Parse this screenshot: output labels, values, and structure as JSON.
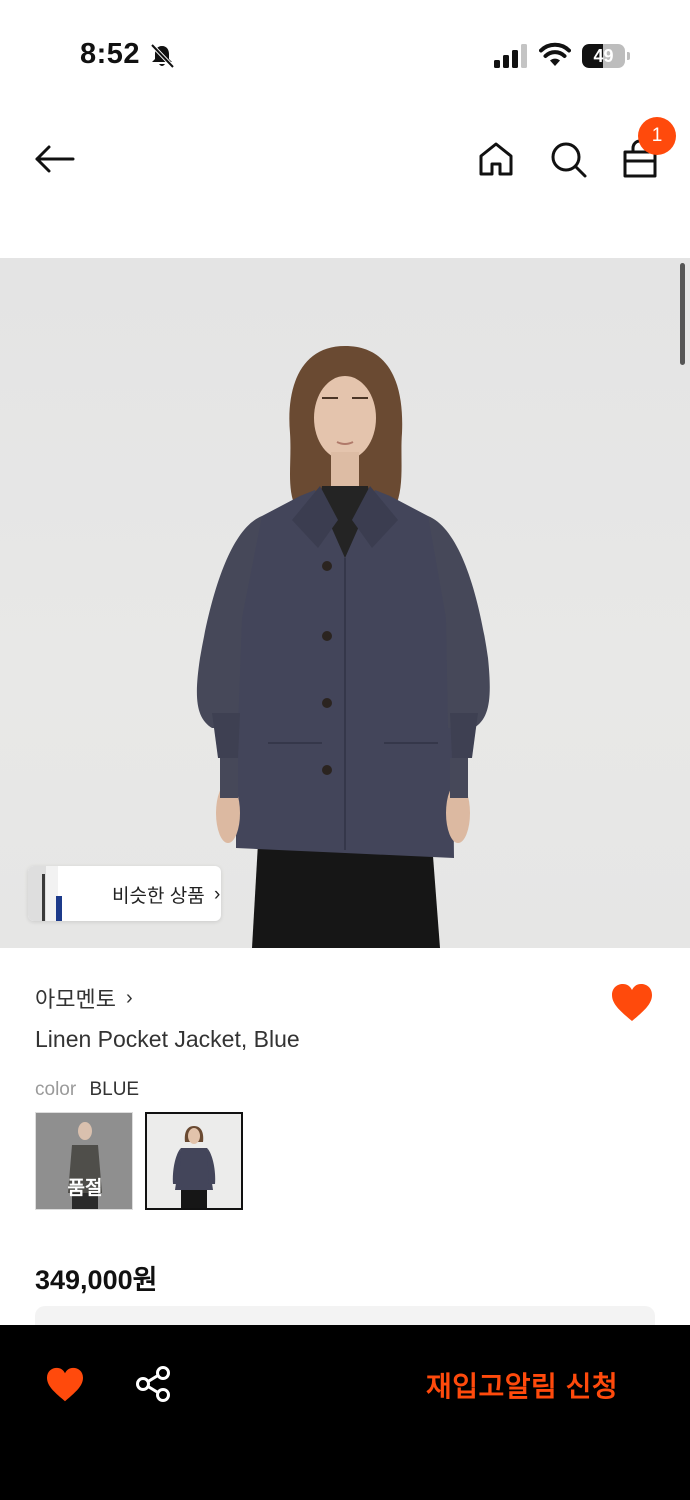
{
  "status_bar": {
    "time": "8:52",
    "battery_level": "49",
    "battery_fraction": 0.49,
    "icons": [
      "bell-off-icon",
      "cellular-signal-icon",
      "wifi-icon",
      "battery-icon"
    ]
  },
  "header": {
    "icons": [
      "back-arrow-icon",
      "home-icon",
      "search-icon",
      "shopping-bag-icon"
    ],
    "cart_count": "1"
  },
  "gallery": {
    "similar_items_label": "비슷한 상품",
    "similar_items_chevron": "›"
  },
  "product": {
    "brand": "아모멘토",
    "brand_chevron": "›",
    "name": "Linen Pocket Jacket, Blue",
    "color_label": "color",
    "color_value": "BLUE",
    "swatches": [
      {
        "status": "품절"
      },
      {
        "status": ""
      }
    ],
    "price": "349,000원"
  },
  "bottom_bar": {
    "restock_alert_label": "재입고알림 신청",
    "icons": [
      "heart-icon",
      "share-icon"
    ]
  },
  "colors": {
    "accent": "#ff4a0c",
    "bottom_bar_bg": "#000000",
    "jacket": "#43455a"
  }
}
